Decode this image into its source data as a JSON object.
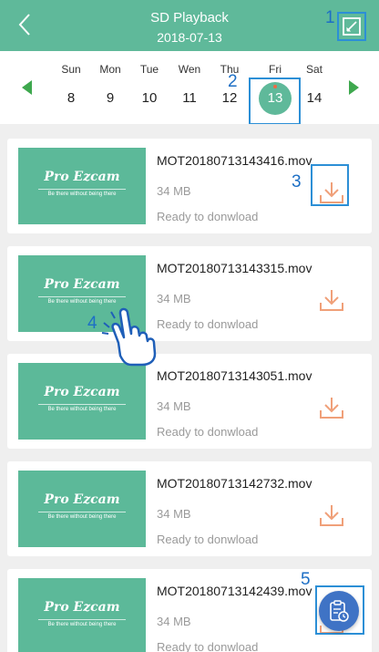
{
  "header": {
    "title": "SD Playback",
    "date": "2018-07-13"
  },
  "callouts": [
    "1",
    "2",
    "3",
    "4",
    "5"
  ],
  "calendar": {
    "days": [
      {
        "name": "Sun",
        "num": "8"
      },
      {
        "name": "Mon",
        "num": "9"
      },
      {
        "name": "Tue",
        "num": "10"
      },
      {
        "name": "Wen",
        "num": "11"
      },
      {
        "name": "Thu",
        "num": "12"
      },
      {
        "name": "Fri",
        "num": "13"
      },
      {
        "name": "Sat",
        "num": "14"
      }
    ],
    "selected_index": 5
  },
  "thumbnail": {
    "brand": "Pro Ezcam",
    "tagline": "Be there without being there"
  },
  "recordings": [
    {
      "name": "MOT20180713143416.mov",
      "size": "34 MB",
      "status": "Ready to donwload"
    },
    {
      "name": "MOT20180713143315.mov",
      "size": "34 MB",
      "status": "Ready to donwload"
    },
    {
      "name": "MOT20180713143051.mov",
      "size": "34 MB",
      "status": "Ready to donwload"
    },
    {
      "name": "MOT20180713142732.mov",
      "size": "34 MB",
      "status": "Ready to donwload"
    },
    {
      "name": "MOT20180713142439.mov",
      "size": "34 MB",
      "status": "Ready to donwload"
    }
  ],
  "colors": {
    "header": "#5fb99a",
    "thumbnail": "#5cb999",
    "download_icon": "#f0a079",
    "fab": "#3f73c5",
    "callout": "#1d6fc5"
  },
  "icons": {
    "back": "chevron-left-icon",
    "edit": "edit-icon",
    "prev": "triangle-left-icon",
    "next": "triangle-right-icon",
    "download": "download-icon",
    "fab": "clipboard-clock-icon",
    "hand": "tap-hand-icon"
  }
}
